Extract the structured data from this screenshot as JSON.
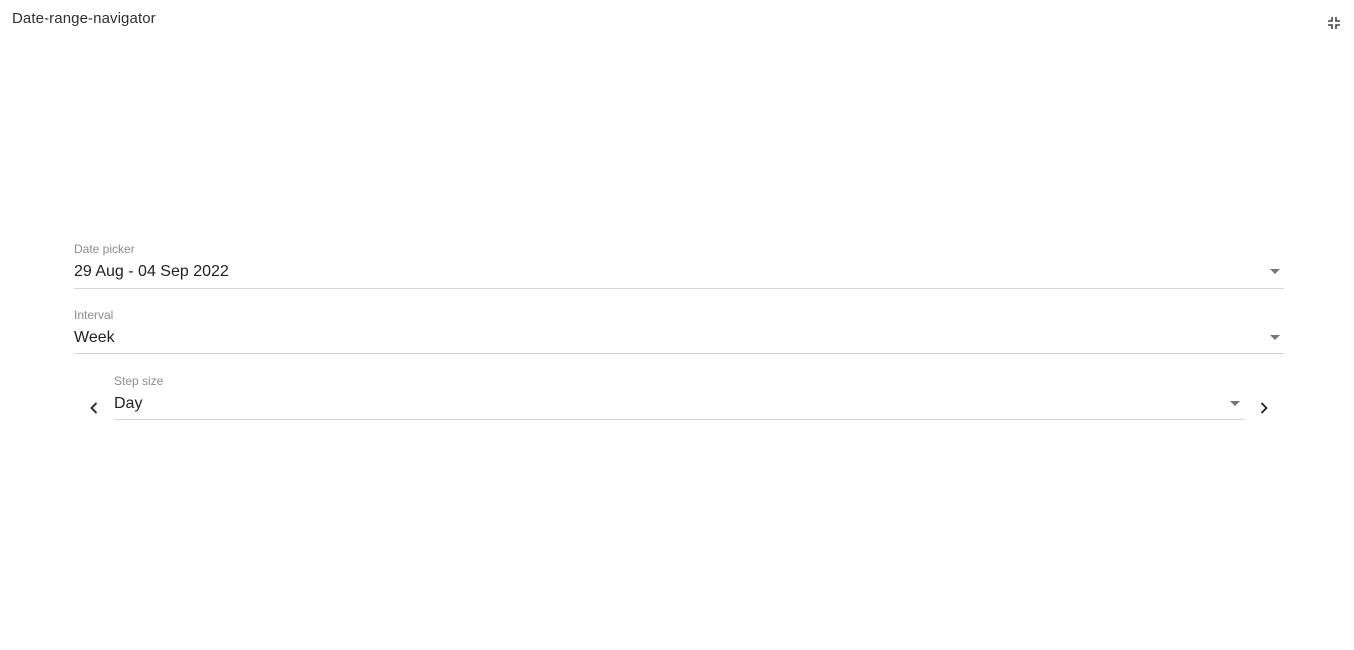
{
  "widget": {
    "title": "Date-range-navigator",
    "exit_fullscreen_icon": "fullscreen-exit-icon"
  },
  "date_picker": {
    "label": "Date picker",
    "value": "29 Aug - 04 Sep 2022"
  },
  "interval": {
    "label": "Interval",
    "value": "Week"
  },
  "step_size": {
    "label": "Step size",
    "value": "Day",
    "prev_icon": "chevron-left-icon",
    "next_icon": "chevron-right-icon"
  }
}
